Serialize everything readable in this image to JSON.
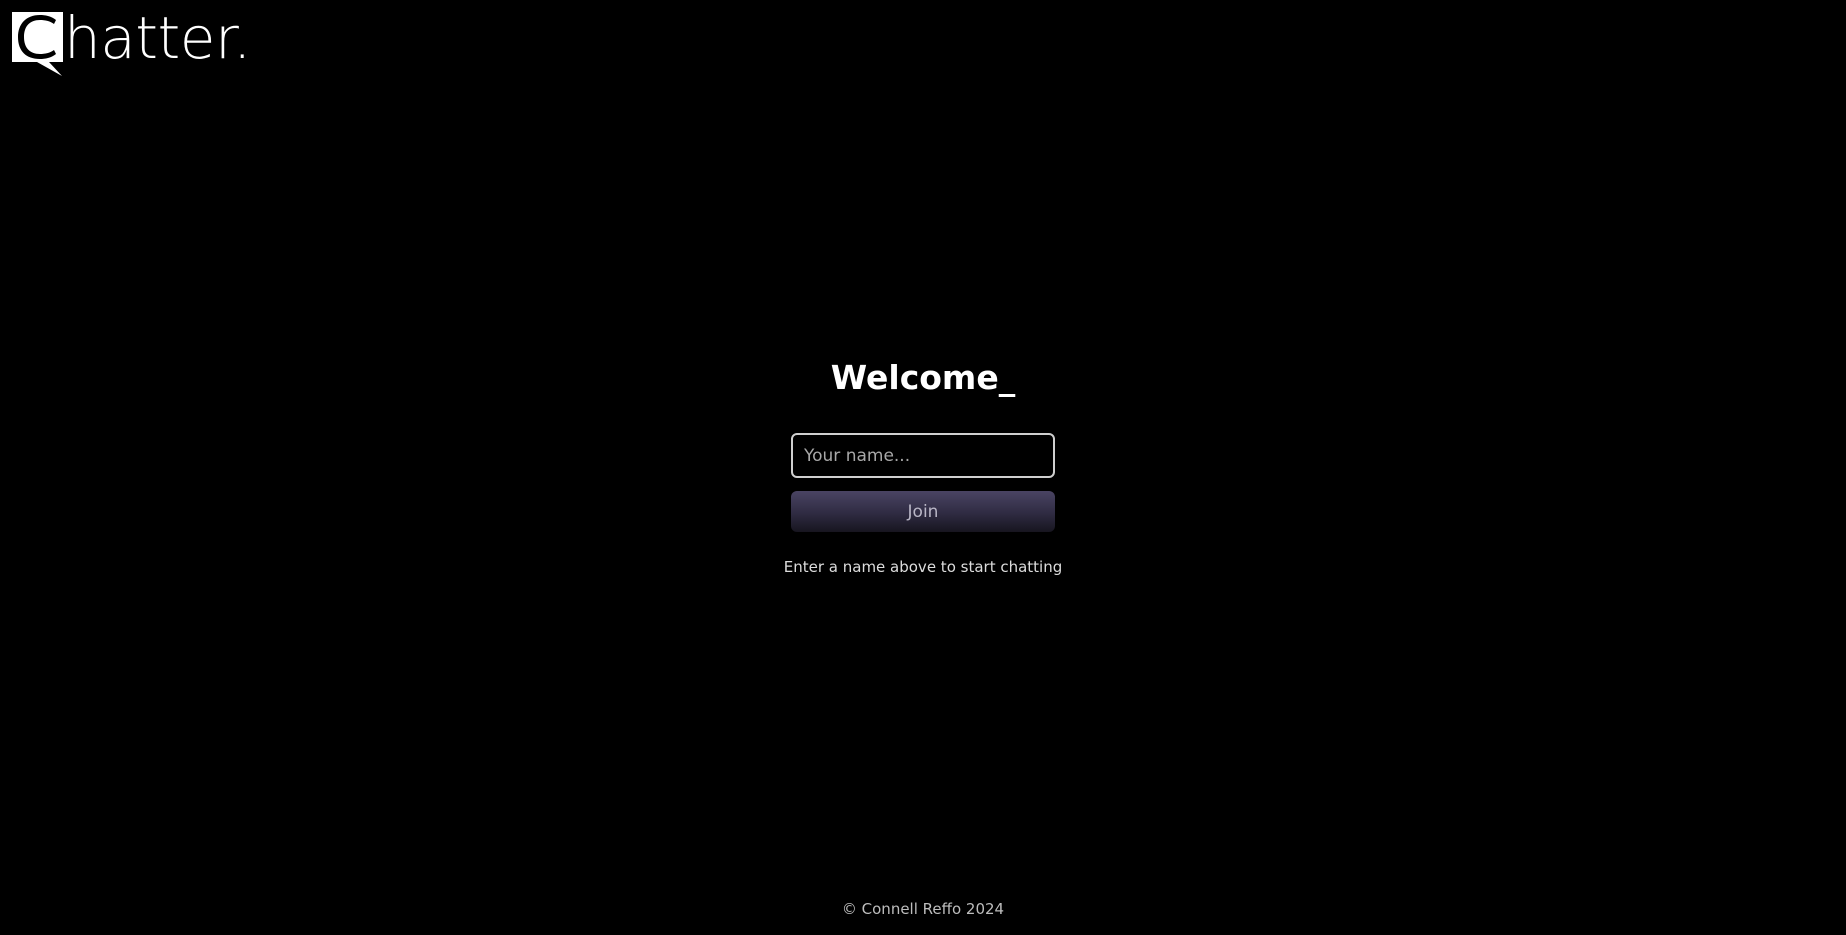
{
  "logo": {
    "text": "hatter.",
    "mark_letter": "C",
    "icon": "chat-bubble-icon"
  },
  "main": {
    "title": "Welcome_",
    "name_input": {
      "placeholder": "Your name...",
      "value": ""
    },
    "join_label": "Join",
    "hint": "Enter a name above to start chatting"
  },
  "footer": {
    "text": "© Connell Reffo 2024"
  },
  "colors": {
    "background": "#000000",
    "text": "#ffffff",
    "button_top": "#4a4463",
    "button_bottom": "#17151f"
  }
}
